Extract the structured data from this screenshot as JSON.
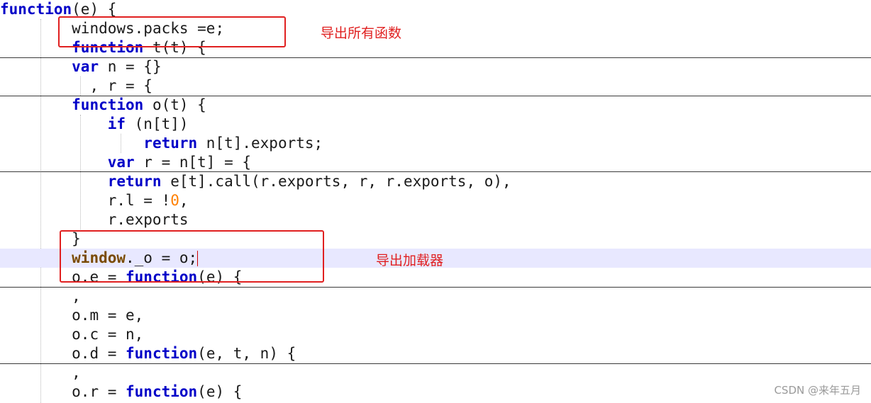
{
  "code_lines": [
    {
      "indent": "",
      "tokens": [
        {
          "t": "function",
          "c": "kw"
        },
        {
          "t": "(e) {"
        }
      ]
    },
    {
      "indent": "        ",
      "tokens": [
        {
          "t": "windows.packs =e;"
        }
      ]
    },
    {
      "indent": "        ",
      "tokens": [
        {
          "t": "function",
          "c": "kw"
        },
        {
          "t": " t(t) {"
        }
      ]
    },
    {
      "indent": "        ",
      "tokens": [
        {
          "t": "var",
          "c": "kw"
        },
        {
          "t": " n = {}"
        }
      ]
    },
    {
      "indent": "          ",
      "tokens": [
        {
          "t": ", r = {"
        }
      ]
    },
    {
      "indent": "        ",
      "tokens": [
        {
          "t": "function",
          "c": "kw"
        },
        {
          "t": " o(t) {"
        }
      ]
    },
    {
      "indent": "            ",
      "tokens": [
        {
          "t": "if",
          "c": "kw"
        },
        {
          "t": " (n[t])"
        }
      ]
    },
    {
      "indent": "                ",
      "tokens": [
        {
          "t": "return",
          "c": "kw"
        },
        {
          "t": " n[t].exports;"
        }
      ]
    },
    {
      "indent": "            ",
      "tokens": [
        {
          "t": "var",
          "c": "kw"
        },
        {
          "t": " r = n[t] = {"
        }
      ]
    },
    {
      "indent": "            ",
      "tokens": [
        {
          "t": "return",
          "c": "kw"
        },
        {
          "t": " e[t].call(r.exports, r, r.exports, o),"
        }
      ]
    },
    {
      "indent": "            ",
      "tokens": [
        {
          "t": "r.l = !"
        },
        {
          "t": "0",
          "c": "num"
        },
        {
          "t": ","
        }
      ]
    },
    {
      "indent": "            ",
      "tokens": [
        {
          "t": "r.exports"
        }
      ]
    },
    {
      "indent": "        ",
      "tokens": [
        {
          "t": "}"
        }
      ]
    },
    {
      "indent": "        ",
      "highlight": true,
      "tokens": [
        {
          "t": "window",
          "c": "kw2"
        },
        {
          "t": "._o = o;"
        },
        {
          "t": "",
          "c": "caret"
        }
      ]
    },
    {
      "indent": "        ",
      "tokens": [
        {
          "t": "o.e = "
        },
        {
          "t": "function",
          "c": "kw"
        },
        {
          "t": "(e) {"
        }
      ]
    },
    {
      "indent": "        ",
      "tokens": [
        {
          "t": ","
        }
      ]
    },
    {
      "indent": "        ",
      "tokens": [
        {
          "t": "o.m = e,"
        }
      ]
    },
    {
      "indent": "        ",
      "tokens": [
        {
          "t": "o.c = n,"
        }
      ]
    },
    {
      "indent": "        ",
      "tokens": [
        {
          "t": "o.d = "
        },
        {
          "t": "function",
          "c": "kw"
        },
        {
          "t": "(e, t, n) {"
        }
      ]
    },
    {
      "indent": "        ",
      "tokens": [
        {
          "t": ","
        }
      ]
    },
    {
      "indent": "        ",
      "tokens": [
        {
          "t": "o.r = "
        },
        {
          "t": "function",
          "c": "kw"
        },
        {
          "t": "(e) {"
        }
      ]
    }
  ],
  "annotations": {
    "export_all": "导出所有函数",
    "export_loader": "导出加载器"
  },
  "watermark": "CSDN @来年五月",
  "colors": {
    "keyword": "#0000c8",
    "window_keyword": "#7a4a00",
    "number": "#ff8000",
    "annotation": "#e02020",
    "highlight_line": "#e8e8ff"
  }
}
